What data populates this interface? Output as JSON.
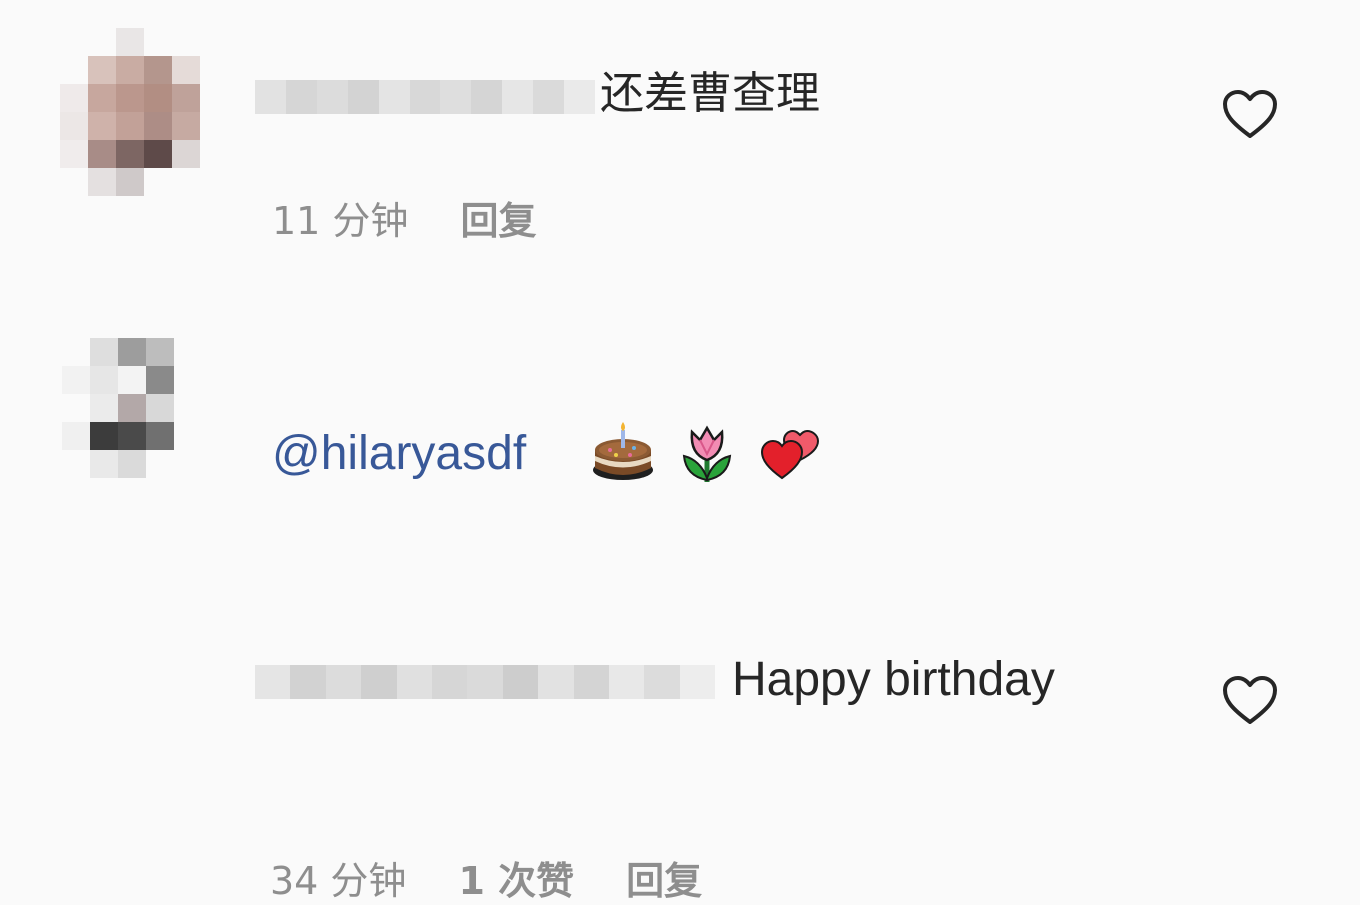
{
  "comments": [
    {
      "text": "还差曹查理",
      "time": "11 分钟",
      "reply_label": "回复",
      "like_icon": "heart-outline-icon"
    },
    {
      "text": "Happy birthday",
      "mention": "@hilaryasdf",
      "emojis": [
        "birthday-cake-icon",
        "tulip-icon",
        "two-hearts-icon"
      ],
      "time": "34 分钟",
      "likes": "1 次赞",
      "reply_label": "回复",
      "like_icon": "heart-outline-icon"
    }
  ],
  "colors": {
    "background": "#fafafa",
    "text": "#262626",
    "meta": "#8e8e8e",
    "mention": "#385898"
  }
}
